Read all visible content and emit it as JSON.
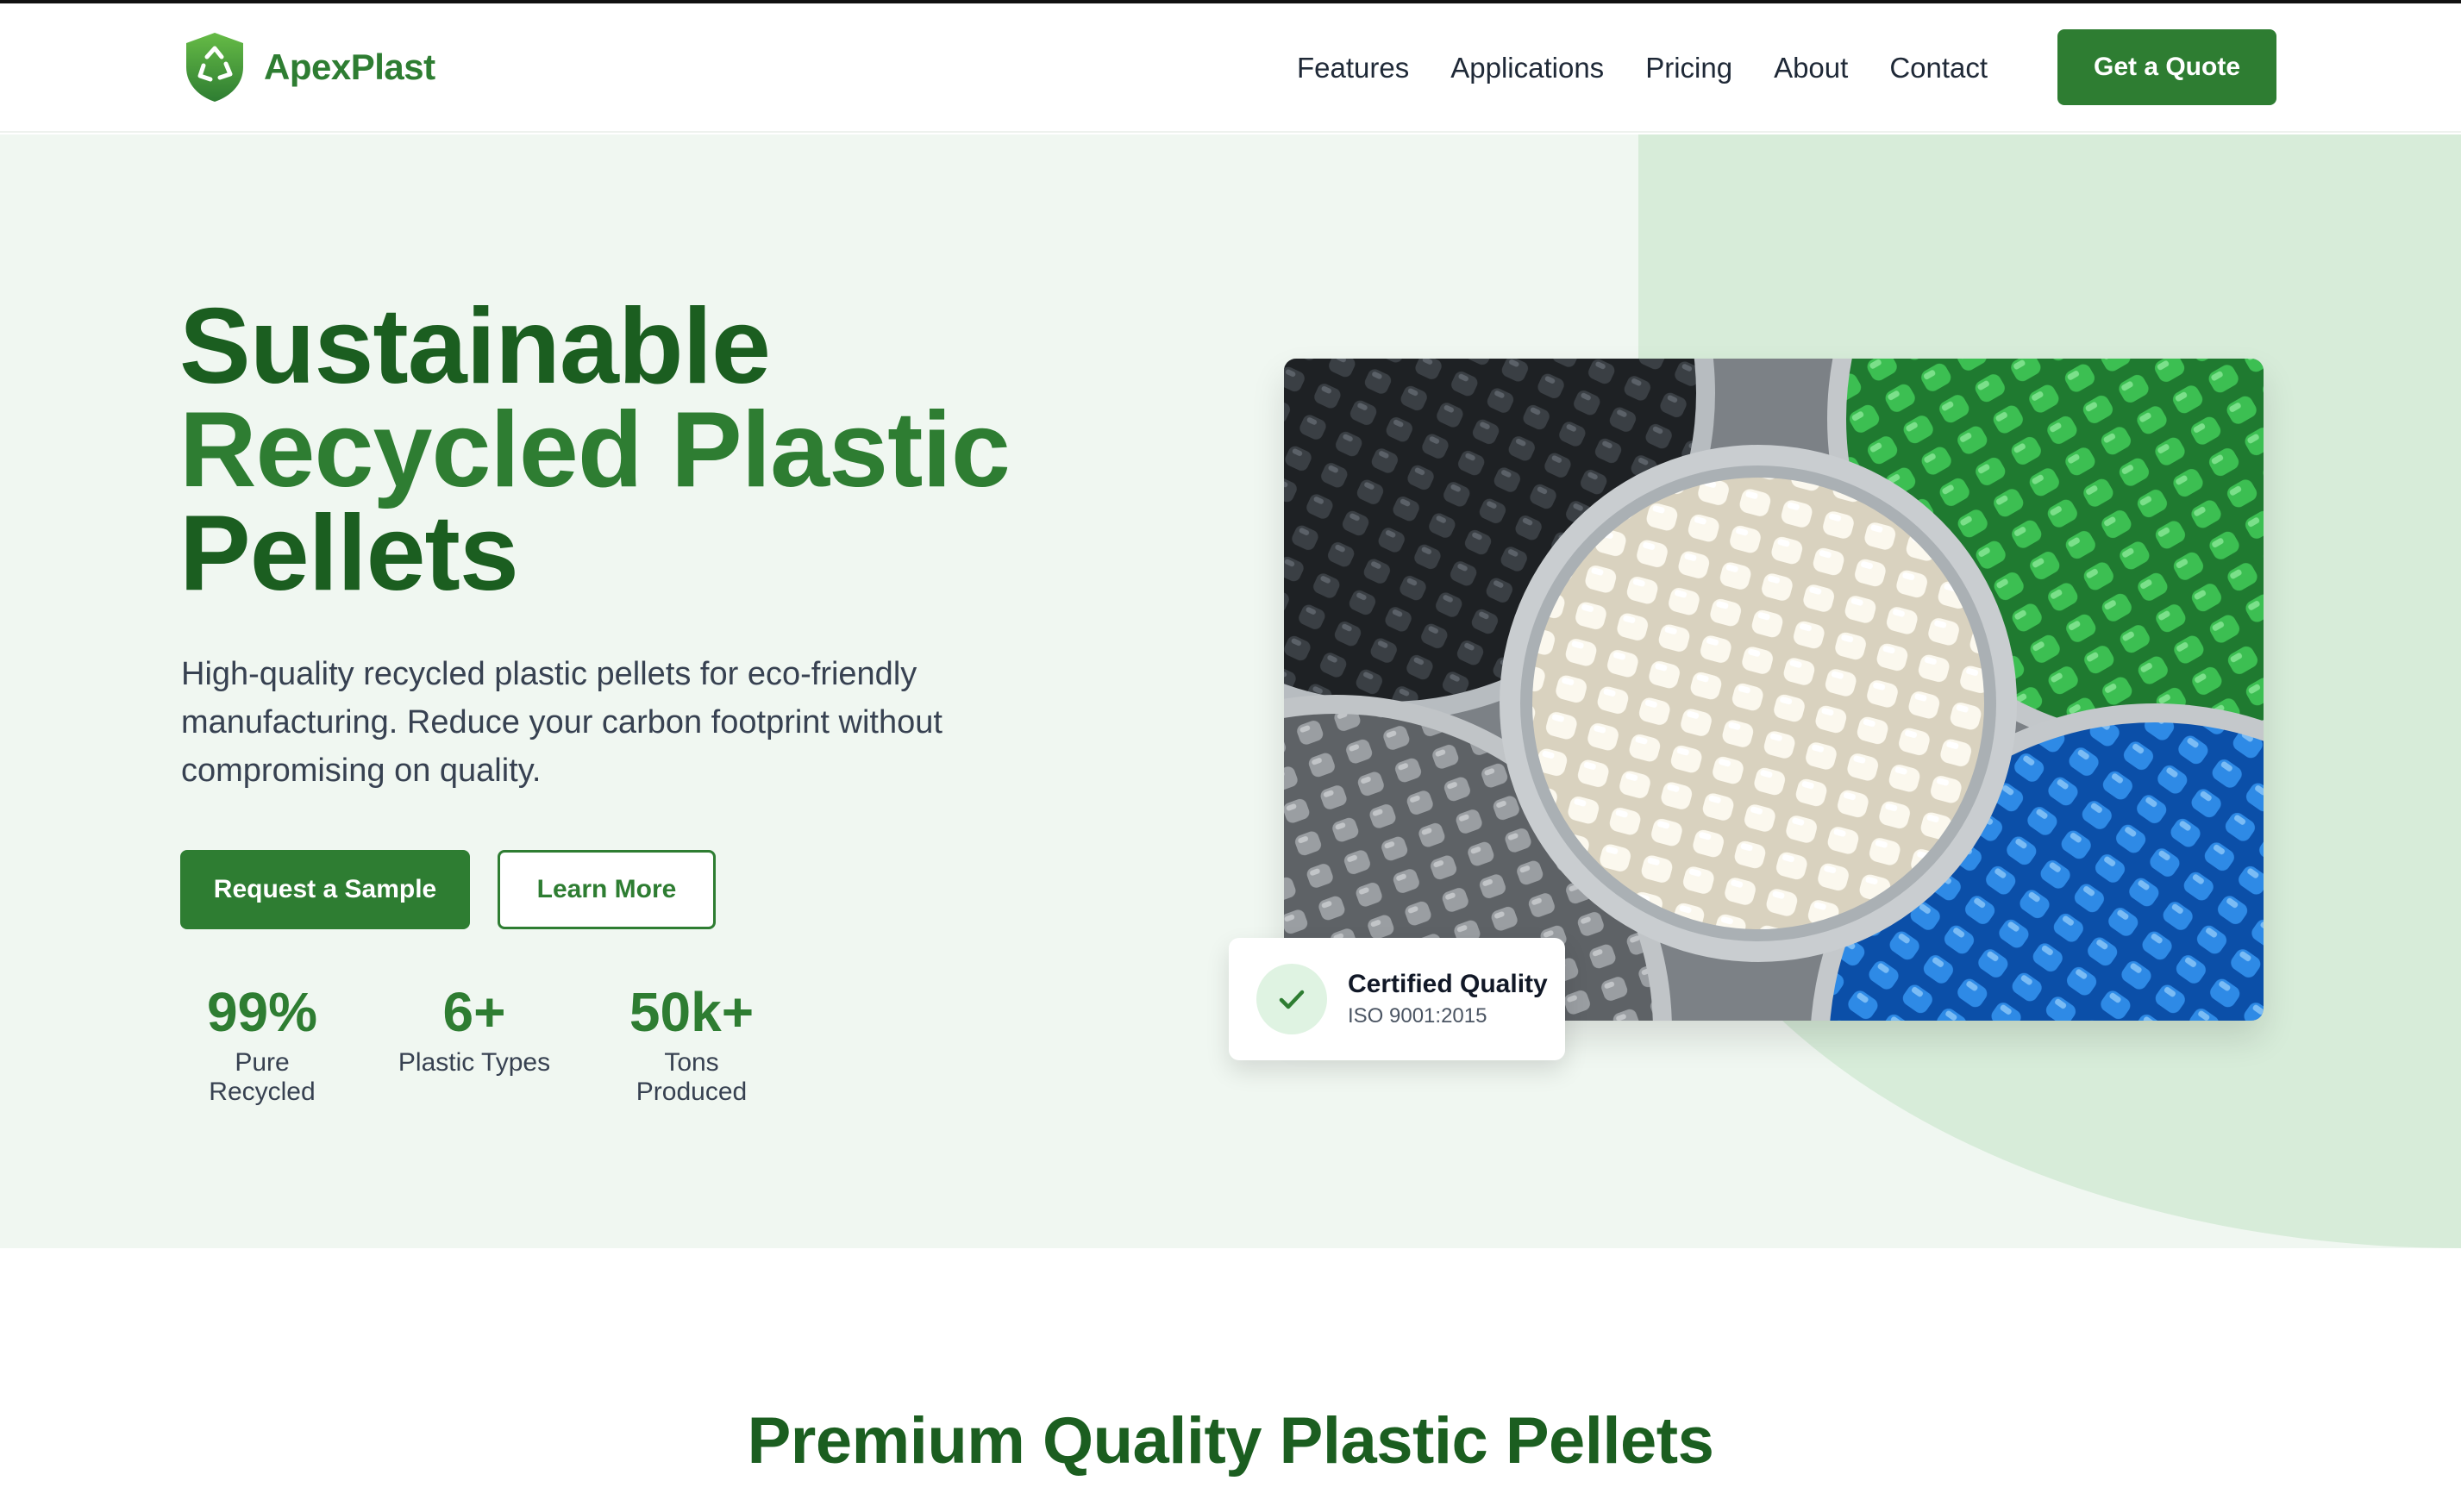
{
  "brand": {
    "name": "ApexPlast",
    "logo_icon": "recycle-shield-icon"
  },
  "nav": {
    "items": [
      {
        "label": "Features"
      },
      {
        "label": "Applications"
      },
      {
        "label": "Pricing"
      },
      {
        "label": "About"
      },
      {
        "label": "Contact"
      }
    ],
    "cta_label": "Get a Quote"
  },
  "hero": {
    "headline": [
      "Sustainable",
      "Recycled Plastic",
      "Pellets"
    ],
    "subtitle": "High-quality recycled plastic pellets for eco-friendly manufacturing. Reduce your carbon footprint without compromising on quality.",
    "primary_button": "Request a Sample",
    "secondary_button": "Learn More",
    "stats": [
      {
        "value": "99%",
        "label": "Pure Recycled"
      },
      {
        "value": "6+",
        "label": "Plastic Types"
      },
      {
        "value": "50k+",
        "label": "Tons Produced"
      }
    ],
    "image_subject": "bowls of black, green, white, grey and blue plastic pellets",
    "badge": {
      "title": "Certified Quality",
      "subtitle": "ISO 9001:2015",
      "icon": "check-icon"
    }
  },
  "section": {
    "title": "Premium Quality Plastic Pellets"
  },
  "colors": {
    "brand_green": "#2e7d32",
    "dark_green": "#1b5e20",
    "hero_bg": "#f0f7f1",
    "accent_bg": "#d7ecd9"
  }
}
